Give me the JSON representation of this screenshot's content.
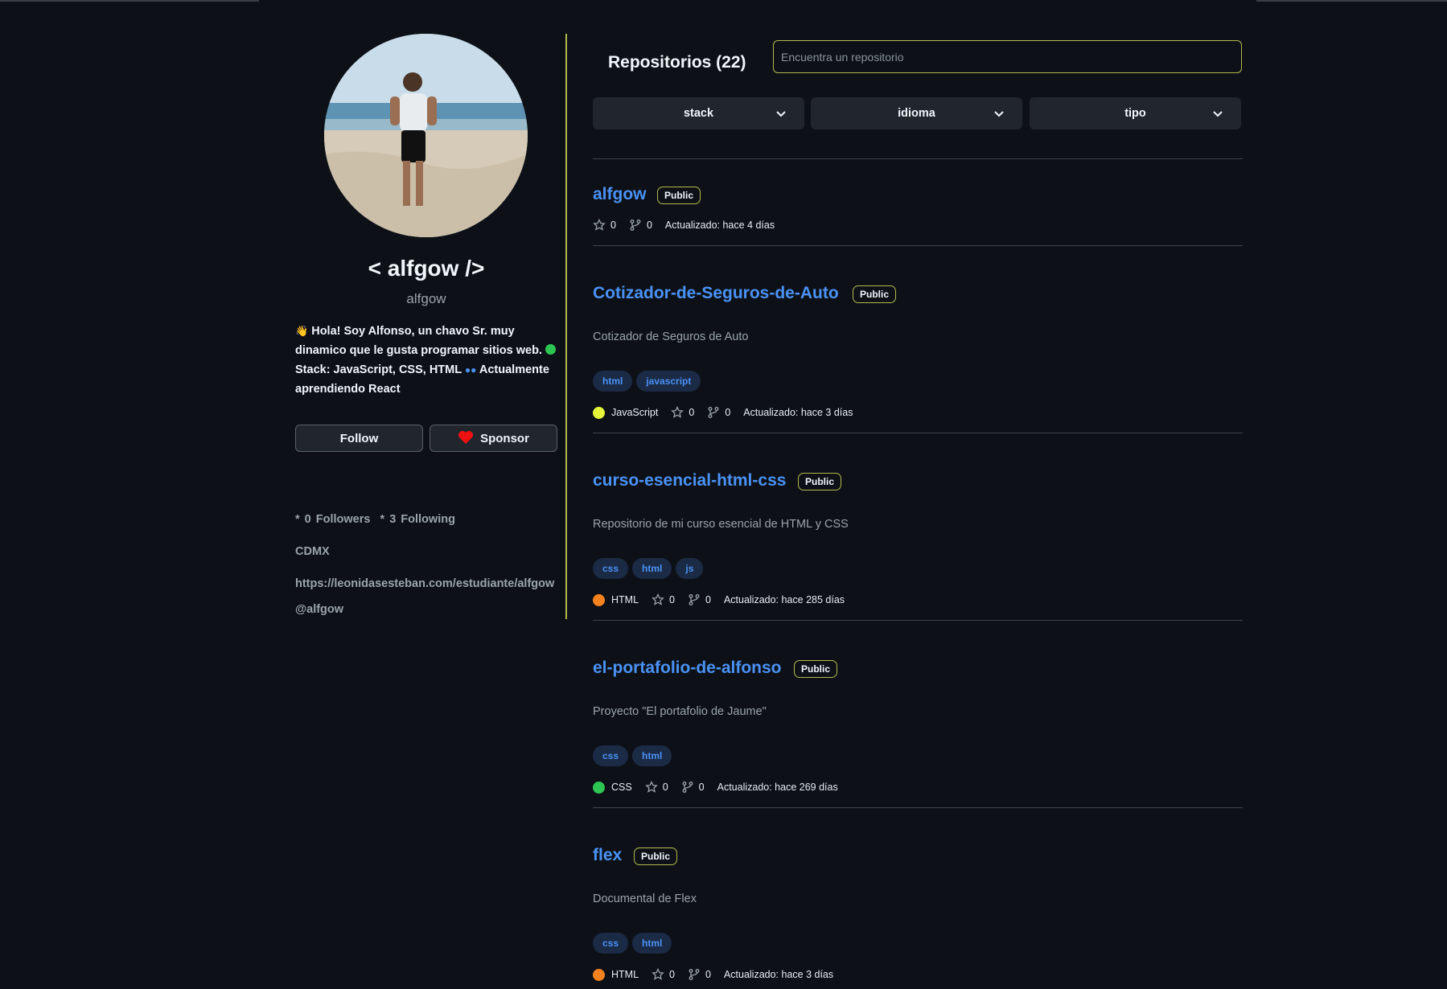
{
  "profile": {
    "display_name": "< alfgow />",
    "username": "alfgow",
    "bio_part1": "Hola! Soy Alfonso, un chavo Sr. muy dinamico que le gusta programar sitios web.",
    "bio_part2": "Stack: JavaScript, CSS, HTML",
    "bio_part3": "Actualmente aprendiendo React",
    "follow_label": "Follow",
    "sponsor_label": "Sponsor",
    "followers_count": "0",
    "followers_label": "Followers",
    "following_count": "3",
    "following_label": "Following",
    "location": "CDMX",
    "website": "https://leonidasesteban.com/estudiante/alfgow",
    "twitter": "@alfgow"
  },
  "repos_header": {
    "title": "Repositorios (22)",
    "search_placeholder": "Encuentra un repositorio"
  },
  "filters": [
    "stack",
    "idioma",
    "tipo"
  ],
  "colors": {
    "accent_link": "#4a92f5",
    "highlight_border": "#b3b94d",
    "lang_javascript": "#e6f53a",
    "lang_html": "#f5821f",
    "lang_css": "#2dc653"
  },
  "repos": [
    {
      "name": "alfgow",
      "visibility": "Public",
      "description": "",
      "tags": [],
      "language": "",
      "stars": "0",
      "forks": "0",
      "updated": "Actualizado: hace 4 días"
    },
    {
      "name": "Cotizador-de-Seguros-de-Auto",
      "visibility": "Public",
      "description": "Cotizador de Seguros de Auto",
      "tags": [
        "html",
        "javascript"
      ],
      "language": "JavaScript",
      "stars": "0",
      "forks": "0",
      "updated": "Actualizado: hace 3 días"
    },
    {
      "name": "curso-esencial-html-css",
      "visibility": "Public",
      "description": "Repositorio de mi curso esencial de HTML y CSS",
      "tags": [
        "css",
        "html",
        "js"
      ],
      "language": "HTML",
      "stars": "0",
      "forks": "0",
      "updated": "Actualizado: hace 285 días"
    },
    {
      "name": "el-portafolio-de-alfonso",
      "visibility": "Public",
      "description": "Proyecto \"El portafolio de Jaume\"",
      "tags": [
        "css",
        "html"
      ],
      "language": "CSS",
      "stars": "0",
      "forks": "0",
      "updated": "Actualizado: hace 269 días"
    },
    {
      "name": "flex",
      "visibility": "Public",
      "description": "Documental de Flex",
      "tags": [
        "css",
        "html"
      ],
      "language": "HTML",
      "stars": "0",
      "forks": "0",
      "updated": "Actualizado: hace 3 días"
    }
  ]
}
